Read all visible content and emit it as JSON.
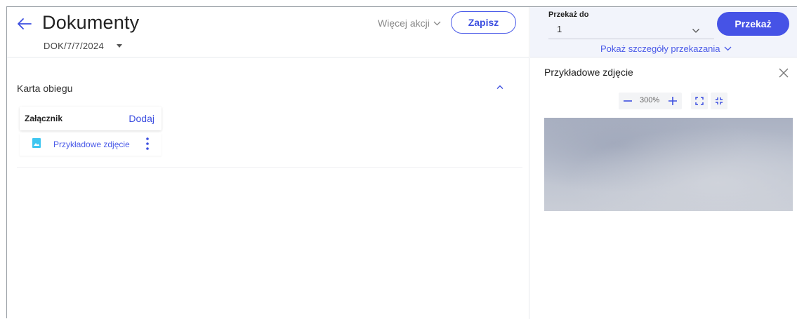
{
  "header": {
    "title": "Dokumenty",
    "doc_number": "DOK/7/7/2024",
    "more_actions": "Więcej akcji",
    "save_label": "Zapisz"
  },
  "section": {
    "title": "Karta obiegu",
    "attachment": {
      "label": "Załącznik",
      "add_label": "Dodaj",
      "files": [
        {
          "name": "Przykładowe zdjęcie"
        }
      ]
    }
  },
  "forward": {
    "label": "Przekaż do",
    "value": "1",
    "button_label": "Przekaż",
    "details_link": "Pokaż szczegóły przekazania"
  },
  "preview": {
    "title": "Przykładowe zdjęcie",
    "zoom_level": "300%"
  },
  "colors": {
    "accent": "#4653e6",
    "link": "#4a5ae8",
    "forward_bar_bg": "#f2f4fb"
  },
  "icons": [
    "back-arrow-icon",
    "chevron-down-icon",
    "chevron-up-icon",
    "image-file-icon",
    "more-vertical-icon",
    "close-icon",
    "minus-icon",
    "plus-icon",
    "expand-icon",
    "shrink-icon"
  ]
}
